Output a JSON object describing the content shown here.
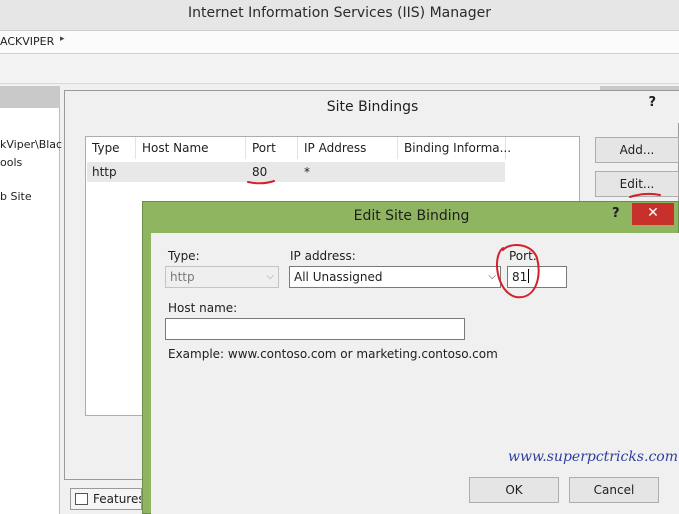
{
  "window": {
    "title": "Internet Information Services (IIS) Manager"
  },
  "address": {
    "crumb": "ACKVIPER",
    "arrow": "▸"
  },
  "left_pane": {
    "items": [
      "kViper\\Blac",
      "ools",
      "b Site"
    ]
  },
  "site_bindings": {
    "title": "Site Bindings",
    "help": "?",
    "columns": [
      "Type",
      "Host Name",
      "Port",
      "IP Address",
      "Binding Informa..."
    ],
    "rows": [
      {
        "type": "http",
        "host": "",
        "port": "80",
        "ip": "*",
        "info": ""
      }
    ],
    "buttons": {
      "add": "Add...",
      "edit": "Edit..."
    }
  },
  "features_tab": {
    "label": "Features View"
  },
  "edit_binding": {
    "title": "Edit Site Binding",
    "help": "?",
    "close": "✕",
    "type_label": "Type:",
    "type_value": "http",
    "ip_label": "IP address:",
    "ip_value": "All Unassigned",
    "port_label": "Port:",
    "port_value": "81",
    "host_label": "Host name:",
    "host_value": "",
    "example": "Example: www.contoso.com or marketing.contoso.com",
    "ok": "OK",
    "cancel": "Cancel",
    "watermark": "www.superpctricks.com™"
  },
  "colors": {
    "annotation": "#d4202a",
    "dialog_frame": "#8fb561",
    "close_button": "#c7302b"
  }
}
